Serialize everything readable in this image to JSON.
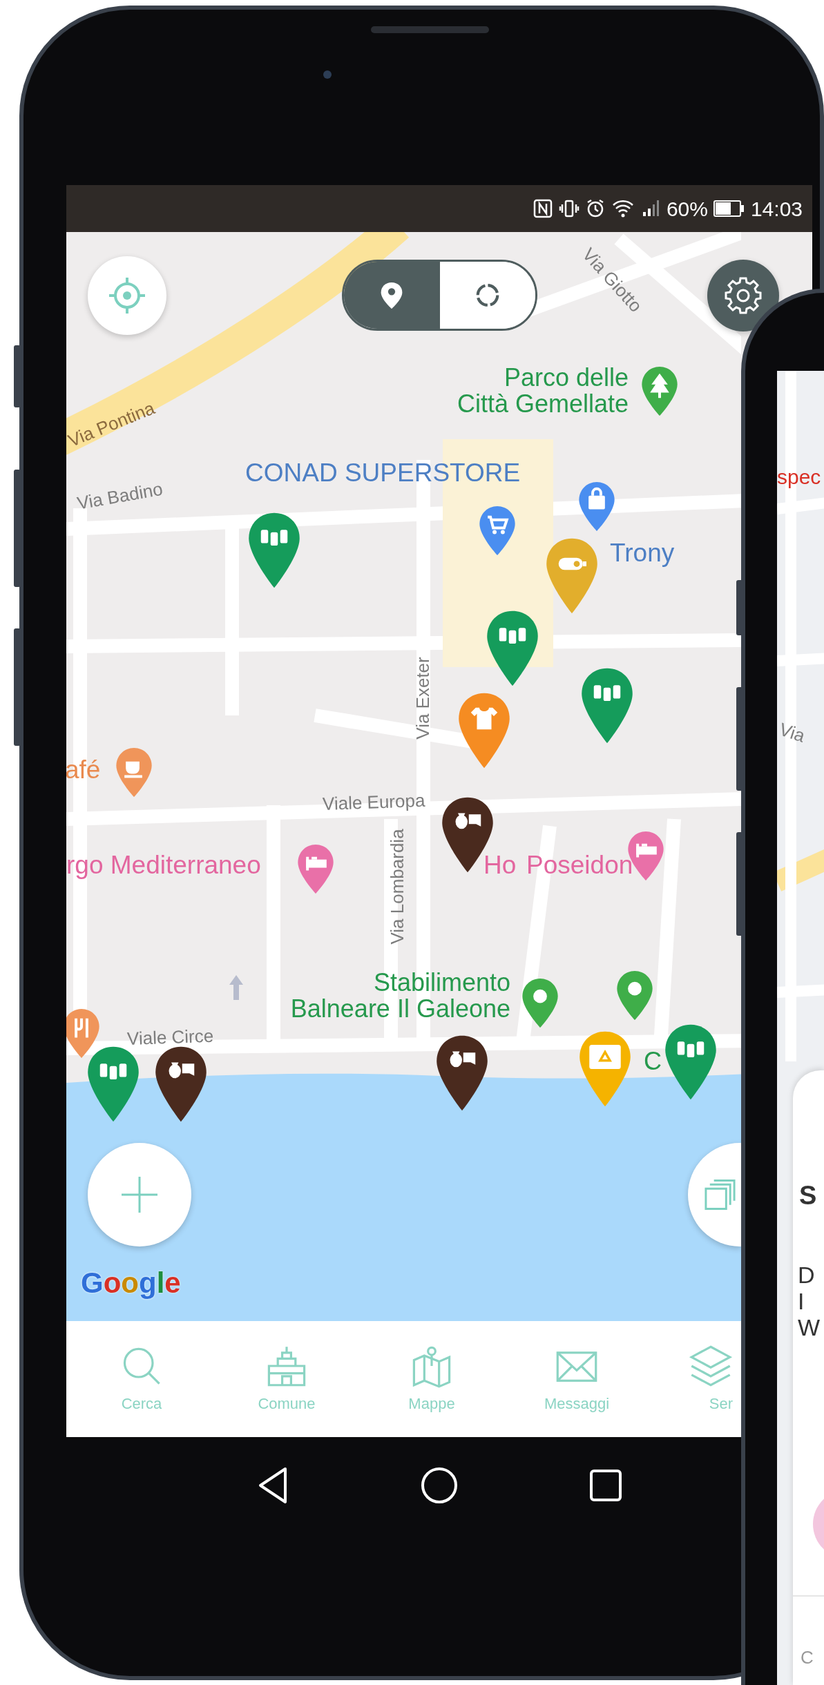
{
  "status_bar": {
    "battery": "60%",
    "time": "14:03"
  },
  "map_controls": {
    "view_toggle": [
      {
        "kind": "pin",
        "selected": true
      },
      {
        "kind": "cycle",
        "selected": false
      }
    ]
  },
  "map_labels": [
    {
      "kind": "street",
      "lines": [
        "Via Giotto"
      ]
    },
    {
      "kind": "highway",
      "lines": [
        "Via Pontina"
      ]
    },
    {
      "kind": "park",
      "lines": [
        "Parco delle",
        "Città Gemellate"
      ]
    },
    {
      "kind": "shop",
      "lines": [
        "CONAD SUPERSTORE"
      ]
    },
    {
      "kind": "street",
      "lines": [
        "Via Badino"
      ]
    },
    {
      "kind": "shop",
      "lines": [
        "Trony"
      ]
    },
    {
      "kind": "street",
      "lines": [
        "Via Exeter"
      ]
    },
    {
      "kind": "food",
      "lines": [
        "afé"
      ]
    },
    {
      "kind": "street",
      "lines": [
        "Viale Europa"
      ]
    },
    {
      "kind": "hotel",
      "lines": [
        "rgo Mediterraneo"
      ]
    },
    {
      "kind": "hotel",
      "lines": [
        "Ho"
      ]
    },
    {
      "kind": "hotel",
      "lines": [
        "Poseidon"
      ]
    },
    {
      "kind": "street",
      "lines": [
        "Via Lombardia"
      ]
    },
    {
      "kind": "park",
      "lines": [
        "Stabilimento",
        "Balneare Il Galeone"
      ]
    },
    {
      "kind": "street",
      "lines": [
        "Viale Circe"
      ]
    },
    {
      "kind": "park",
      "lines": [
        "C"
      ]
    }
  ],
  "map_places": [
    {
      "kind": "park"
    },
    {
      "kind": "shopping"
    },
    {
      "kind": "store"
    },
    {
      "kind": "cafe"
    },
    {
      "kind": "hotel"
    },
    {
      "kind": "hotel"
    },
    {
      "kind": "restaurant"
    },
    {
      "kind": "place"
    },
    {
      "kind": "place"
    }
  ],
  "map_markers": [
    {
      "kind": "bins",
      "color": "#159c5b"
    },
    {
      "kind": "battery",
      "color": "#e2ae2c"
    },
    {
      "kind": "bins",
      "color": "#159c5b"
    },
    {
      "kind": "clothes",
      "color": "#f58c22"
    },
    {
      "kind": "bins",
      "color": "#159c5b"
    },
    {
      "kind": "organic",
      "color": "#4a2a1e"
    },
    {
      "kind": "bins",
      "color": "#159c5b"
    },
    {
      "kind": "organic",
      "color": "#4a2a1e"
    },
    {
      "kind": "organic",
      "color": "#4a2a1e"
    },
    {
      "kind": "recycling",
      "color": "#f5b300"
    },
    {
      "kind": "bins",
      "color": "#159c5b"
    }
  ],
  "google_logo": "Google",
  "bottom_nav": [
    {
      "kind": "search",
      "label": "Cerca"
    },
    {
      "kind": "townhall",
      "label": "Comune"
    },
    {
      "kind": "map",
      "label": "Mappe"
    },
    {
      "kind": "mail",
      "label": "Messaggi"
    },
    {
      "kind": "layers",
      "label": "Ser"
    }
  ],
  "second_phone": {
    "map_label": "spec",
    "street_label": "Via",
    "card_title": "S",
    "card_text": [
      "D",
      "I",
      "W"
    ],
    "footer": "C"
  }
}
